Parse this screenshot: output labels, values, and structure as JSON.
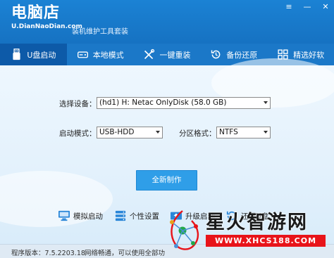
{
  "app": {
    "logo_main": "电脑店",
    "logo_sub": "U.DianNaoDian.com",
    "slogan": "装机维护工具套装",
    "window_buttons": [
      "≡",
      "—",
      "✕"
    ]
  },
  "nav": [
    {
      "label": "U盘启动",
      "icon": "usb-drive-icon",
      "active": true
    },
    {
      "label": "本地模式",
      "icon": "hard-disk-icon",
      "active": false
    },
    {
      "label": "一键重装",
      "icon": "tools-icon",
      "active": false
    },
    {
      "label": "备份还原",
      "icon": "restore-icon",
      "active": false
    },
    {
      "label": "精选好软",
      "icon": "apps-grid-icon",
      "active": false
    }
  ],
  "form": {
    "device_label": "选择设备：",
    "device_value": "(hd1) H: Netac OnlyDisk (58.0 GB)",
    "mode_label": "启动模式：",
    "mode_value": "USB-HDD",
    "partition_label": "分区格式：",
    "partition_value": "NTFS",
    "create_button": "全新制作"
  },
  "tools": [
    {
      "label": "模拟启动",
      "icon": "monitor-icon"
    },
    {
      "label": "个性设置",
      "icon": "server-settings-icon"
    },
    {
      "label": "升级启动",
      "icon": "upgrade-icon"
    },
    {
      "label": "还原U盘",
      "icon": "restore-usb-icon"
    }
  ],
  "status": {
    "version": "程序版本：7.5.2203.18",
    "network": "网络畅通，可以使用全部功"
  },
  "watermark": {
    "text": "星火智游网",
    "url": "WWW.XHCS188.COM"
  },
  "colors": {
    "header": "#1b82d4",
    "nav_active": "#0d5aa8",
    "primary_button": "#2f9ee8",
    "watermark_red": "#e8141a"
  }
}
